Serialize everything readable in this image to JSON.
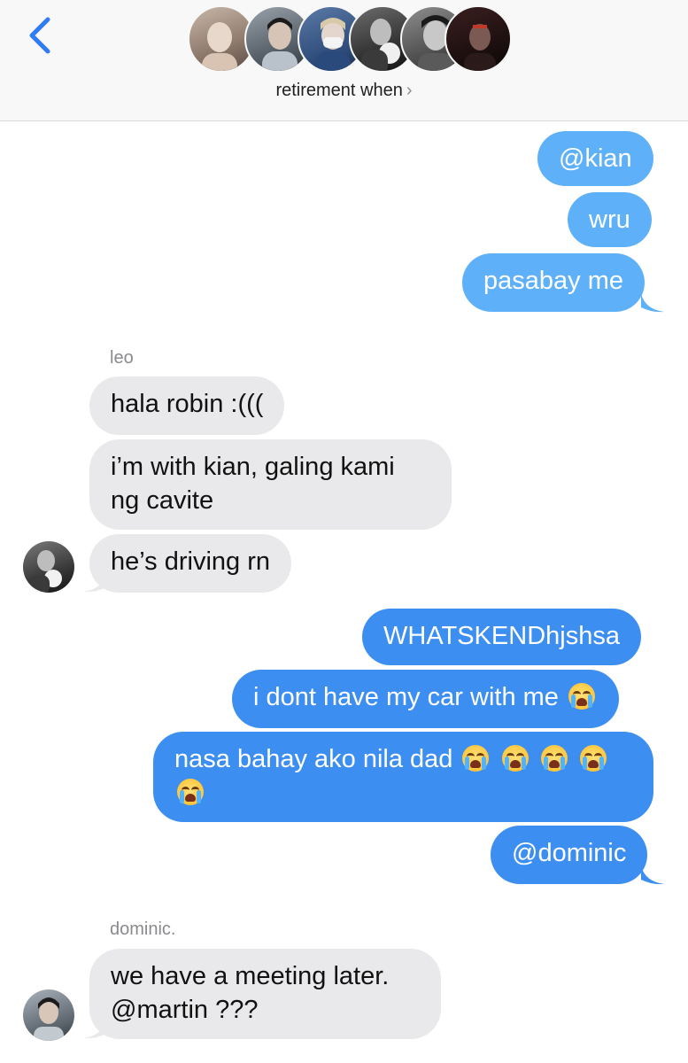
{
  "header": {
    "group_name": "retirement when",
    "chevron": "›",
    "back_icon": "chevron-left-icon",
    "member_avatar_count": 6
  },
  "messages": [
    {
      "side": "outgoing",
      "text": "@kian"
    },
    {
      "side": "outgoing",
      "text": "wru"
    },
    {
      "side": "outgoing",
      "text": "pasabay me"
    },
    {
      "side": "incoming",
      "sender": "leo",
      "text": "hala robin :((("
    },
    {
      "side": "incoming",
      "text_line1": "i’m with kian, galing kami",
      "text_line2": "ng cavite"
    },
    {
      "side": "incoming",
      "text": "he’s driving rn"
    },
    {
      "side": "outgoing",
      "text": "WHATSKENDhjshsa"
    },
    {
      "side": "outgoing",
      "text": "i dont have my car with me",
      "emoji": "loudly-crying-face"
    },
    {
      "side": "outgoing",
      "text": "nasa bahay ako nila dad",
      "emoji": "loudly-crying-face",
      "emoji_count": 5
    },
    {
      "side": "outgoing",
      "text": "@dominic"
    },
    {
      "side": "incoming",
      "sender": "dominic.",
      "text_line1": "we have a meeting later.",
      "text_line2": "@martin ???"
    }
  ],
  "colors": {
    "outgoing_light": "#5eb1f9",
    "outgoing_deep": "#3d8ef1",
    "incoming": "#e9e9eb",
    "accent": "#2f7cf6"
  }
}
